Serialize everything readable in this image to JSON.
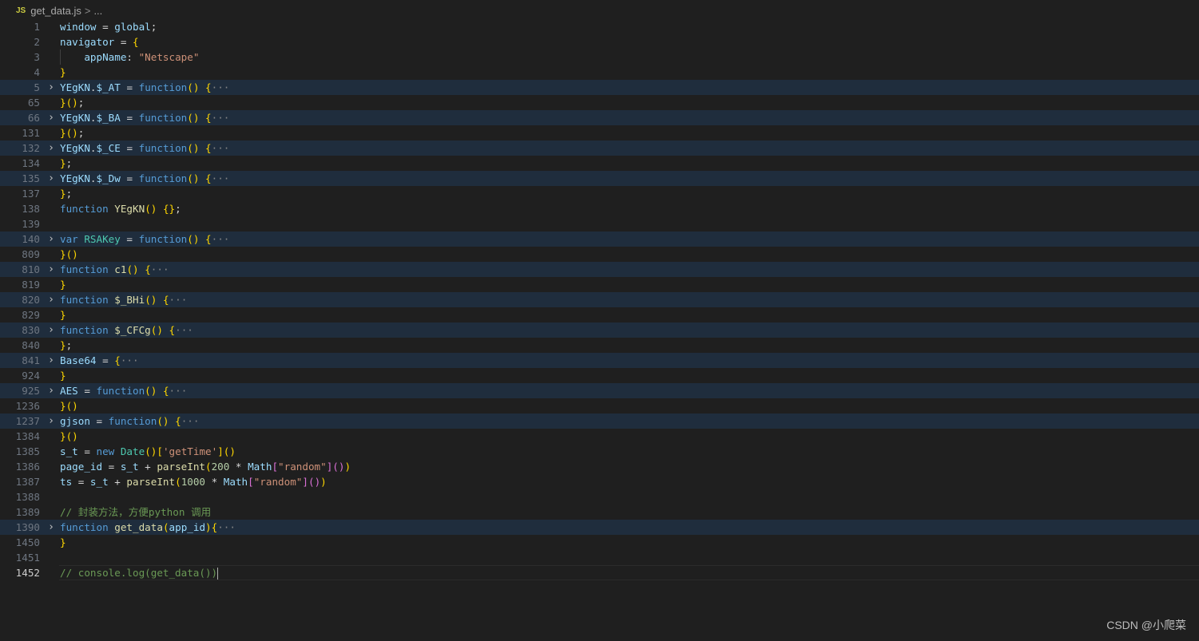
{
  "breadcrumb": {
    "file_badge": "JS",
    "file_name": "get_data.js",
    "separator": ">",
    "more": "..."
  },
  "watermark": "CSDN @小爬菜",
  "lines": [
    {
      "n": "1",
      "folded": false,
      "tokens": [
        [
          "window",
          "var"
        ],
        [
          " = ",
          "p"
        ],
        [
          "global",
          "var"
        ],
        [
          ";",
          "p"
        ]
      ]
    },
    {
      "n": "2",
      "folded": false,
      "tokens": [
        [
          "navigator",
          "var"
        ],
        [
          " = ",
          "p"
        ],
        [
          "{",
          "b1"
        ]
      ]
    },
    {
      "n": "3",
      "folded": false,
      "guide": true,
      "tokens": [
        [
          "    ",
          "p"
        ],
        [
          "appName",
          "var"
        ],
        [
          ": ",
          "p"
        ],
        [
          "\"Netscape\"",
          "str"
        ]
      ]
    },
    {
      "n": "4",
      "folded": false,
      "tokens": [
        [
          "}",
          "b1"
        ]
      ]
    },
    {
      "n": "5",
      "folded": true,
      "tokens": [
        [
          "YEgKN",
          "var"
        ],
        [
          ".",
          "p"
        ],
        [
          "$_AT",
          "var"
        ],
        [
          " = ",
          "p"
        ],
        [
          "function",
          "kw"
        ],
        [
          "()",
          "b1"
        ],
        [
          " ",
          "p"
        ],
        [
          "{",
          "b1"
        ],
        [
          "···",
          "ell"
        ]
      ]
    },
    {
      "n": "65",
      "folded": false,
      "tokens": [
        [
          "}",
          "b1"
        ],
        [
          "()",
          "b1"
        ],
        [
          ";",
          "p"
        ]
      ]
    },
    {
      "n": "66",
      "folded": true,
      "tokens": [
        [
          "YEgKN",
          "var"
        ],
        [
          ".",
          "p"
        ],
        [
          "$_BA",
          "var"
        ],
        [
          " = ",
          "p"
        ],
        [
          "function",
          "kw"
        ],
        [
          "()",
          "b1"
        ],
        [
          " ",
          "p"
        ],
        [
          "{",
          "b1"
        ],
        [
          "···",
          "ell"
        ]
      ]
    },
    {
      "n": "131",
      "folded": false,
      "tokens": [
        [
          "}",
          "b1"
        ],
        [
          "()",
          "b1"
        ],
        [
          ";",
          "p"
        ]
      ]
    },
    {
      "n": "132",
      "folded": true,
      "tokens": [
        [
          "YEgKN",
          "var"
        ],
        [
          ".",
          "p"
        ],
        [
          "$_CE",
          "var"
        ],
        [
          " = ",
          "p"
        ],
        [
          "function",
          "kw"
        ],
        [
          "()",
          "b1"
        ],
        [
          " ",
          "p"
        ],
        [
          "{",
          "b1"
        ],
        [
          "···",
          "ell"
        ]
      ]
    },
    {
      "n": "134",
      "folded": false,
      "tokens": [
        [
          "}",
          "b1"
        ],
        [
          ";",
          "p"
        ]
      ]
    },
    {
      "n": "135",
      "folded": true,
      "tokens": [
        [
          "YEgKN",
          "var"
        ],
        [
          ".",
          "p"
        ],
        [
          "$_Dw",
          "var"
        ],
        [
          " = ",
          "p"
        ],
        [
          "function",
          "kw"
        ],
        [
          "()",
          "b1"
        ],
        [
          " ",
          "p"
        ],
        [
          "{",
          "b1"
        ],
        [
          "···",
          "ell"
        ]
      ]
    },
    {
      "n": "137",
      "folded": false,
      "tokens": [
        [
          "}",
          "b1"
        ],
        [
          ";",
          "p"
        ]
      ]
    },
    {
      "n": "138",
      "folded": false,
      "tokens": [
        [
          "function",
          "kw"
        ],
        [
          " ",
          "p"
        ],
        [
          "YEgKN",
          "fn"
        ],
        [
          "()",
          "b1"
        ],
        [
          " ",
          "p"
        ],
        [
          "{}",
          "b1"
        ],
        [
          ";",
          "p"
        ]
      ]
    },
    {
      "n": "139",
      "folded": false,
      "tokens": []
    },
    {
      "n": "140",
      "folded": true,
      "tokens": [
        [
          "var",
          "kw"
        ],
        [
          " ",
          "p"
        ],
        [
          "RSAKey",
          "cls"
        ],
        [
          " = ",
          "p"
        ],
        [
          "function",
          "kw"
        ],
        [
          "()",
          "b1"
        ],
        [
          " ",
          "p"
        ],
        [
          "{",
          "b1"
        ],
        [
          "···",
          "ell"
        ]
      ]
    },
    {
      "n": "809",
      "folded": false,
      "tokens": [
        [
          "}",
          "b1"
        ],
        [
          "()",
          "b1"
        ]
      ]
    },
    {
      "n": "810",
      "folded": true,
      "tokens": [
        [
          "function",
          "kw"
        ],
        [
          " ",
          "p"
        ],
        [
          "c1",
          "fn"
        ],
        [
          "()",
          "b1"
        ],
        [
          " ",
          "p"
        ],
        [
          "{",
          "b1"
        ],
        [
          "···",
          "ell"
        ]
      ]
    },
    {
      "n": "819",
      "folded": false,
      "tokens": [
        [
          "}",
          "b1"
        ]
      ]
    },
    {
      "n": "820",
      "folded": true,
      "tokens": [
        [
          "function",
          "kw"
        ],
        [
          " ",
          "p"
        ],
        [
          "$_BHi",
          "fn"
        ],
        [
          "()",
          "b1"
        ],
        [
          " ",
          "p"
        ],
        [
          "{",
          "b1"
        ],
        [
          "···",
          "ell"
        ]
      ]
    },
    {
      "n": "829",
      "folded": false,
      "tokens": [
        [
          "}",
          "b1"
        ]
      ]
    },
    {
      "n": "830",
      "folded": true,
      "tokens": [
        [
          "function",
          "kw"
        ],
        [
          " ",
          "p"
        ],
        [
          "$_CFCg",
          "fn"
        ],
        [
          "()",
          "b1"
        ],
        [
          " ",
          "p"
        ],
        [
          "{",
          "b1"
        ],
        [
          "···",
          "ell"
        ]
      ]
    },
    {
      "n": "840",
      "folded": false,
      "tokens": [
        [
          "}",
          "b1"
        ],
        [
          ";",
          "p"
        ]
      ]
    },
    {
      "n": "841",
      "folded": true,
      "tokens": [
        [
          "Base64",
          "var"
        ],
        [
          " = ",
          "p"
        ],
        [
          "{",
          "b1"
        ],
        [
          "···",
          "ell"
        ]
      ]
    },
    {
      "n": "924",
      "folded": false,
      "tokens": [
        [
          "}",
          "b1"
        ]
      ]
    },
    {
      "n": "925",
      "folded": true,
      "tokens": [
        [
          "AES",
          "var"
        ],
        [
          " = ",
          "p"
        ],
        [
          "function",
          "kw"
        ],
        [
          "()",
          "b1"
        ],
        [
          " ",
          "p"
        ],
        [
          "{",
          "b1"
        ],
        [
          "···",
          "ell"
        ]
      ]
    },
    {
      "n": "1236",
      "folded": false,
      "tokens": [
        [
          "}",
          "b1"
        ],
        [
          "()",
          "b1"
        ]
      ]
    },
    {
      "n": "1237",
      "folded": true,
      "tokens": [
        [
          "gjson",
          "var"
        ],
        [
          " = ",
          "p"
        ],
        [
          "function",
          "kw"
        ],
        [
          "()",
          "b1"
        ],
        [
          " ",
          "p"
        ],
        [
          "{",
          "b1"
        ],
        [
          "···",
          "ell"
        ]
      ]
    },
    {
      "n": "1384",
      "folded": false,
      "tokens": [
        [
          "}",
          "b1"
        ],
        [
          "()",
          "b1"
        ]
      ]
    },
    {
      "n": "1385",
      "folded": false,
      "tokens": [
        [
          "s_t",
          "var"
        ],
        [
          " = ",
          "p"
        ],
        [
          "new",
          "kw"
        ],
        [
          " ",
          "p"
        ],
        [
          "Date",
          "cls"
        ],
        [
          "()",
          "b1"
        ],
        [
          "[",
          "b1"
        ],
        [
          "'getTime'",
          "str"
        ],
        [
          "]",
          "b1"
        ],
        [
          "()",
          "b1"
        ]
      ]
    },
    {
      "n": "1386",
      "folded": false,
      "tokens": [
        [
          "page_id",
          "var"
        ],
        [
          " = ",
          "p"
        ],
        [
          "s_t",
          "var"
        ],
        [
          " + ",
          "p"
        ],
        [
          "parseInt",
          "fn"
        ],
        [
          "(",
          "b1"
        ],
        [
          "200",
          "num"
        ],
        [
          " * ",
          "p"
        ],
        [
          "Math",
          "var"
        ],
        [
          "[",
          "b2"
        ],
        [
          "\"random\"",
          "str"
        ],
        [
          "]",
          "b2"
        ],
        [
          "()",
          "b2"
        ],
        [
          ")",
          "b1"
        ]
      ]
    },
    {
      "n": "1387",
      "folded": false,
      "tokens": [
        [
          "ts",
          "var"
        ],
        [
          " = ",
          "p"
        ],
        [
          "s_t",
          "var"
        ],
        [
          " + ",
          "p"
        ],
        [
          "parseInt",
          "fn"
        ],
        [
          "(",
          "b1"
        ],
        [
          "1000",
          "num"
        ],
        [
          " * ",
          "p"
        ],
        [
          "Math",
          "var"
        ],
        [
          "[",
          "b2"
        ],
        [
          "\"random\"",
          "str"
        ],
        [
          "]",
          "b2"
        ],
        [
          "()",
          "b2"
        ],
        [
          ")",
          "b1"
        ]
      ]
    },
    {
      "n": "1388",
      "folded": false,
      "tokens": []
    },
    {
      "n": "1389",
      "folded": false,
      "tokens": [
        [
          "// 封装方法，方便python 调用",
          "com"
        ]
      ]
    },
    {
      "n": "1390",
      "folded": true,
      "tokens": [
        [
          "function",
          "kw"
        ],
        [
          " ",
          "p"
        ],
        [
          "get_data",
          "fn"
        ],
        [
          "(",
          "b1"
        ],
        [
          "app_id",
          "var"
        ],
        [
          ")",
          "b1"
        ],
        [
          "{",
          "b1"
        ],
        [
          "···",
          "ell"
        ]
      ]
    },
    {
      "n": "1450",
      "folded": false,
      "tokens": [
        [
          "}",
          "b1"
        ]
      ]
    },
    {
      "n": "1451",
      "folded": false,
      "tokens": []
    },
    {
      "n": "1452",
      "folded": false,
      "cursor": true,
      "tokens": [
        [
          "// console.log(get_data())",
          "com"
        ]
      ]
    }
  ]
}
